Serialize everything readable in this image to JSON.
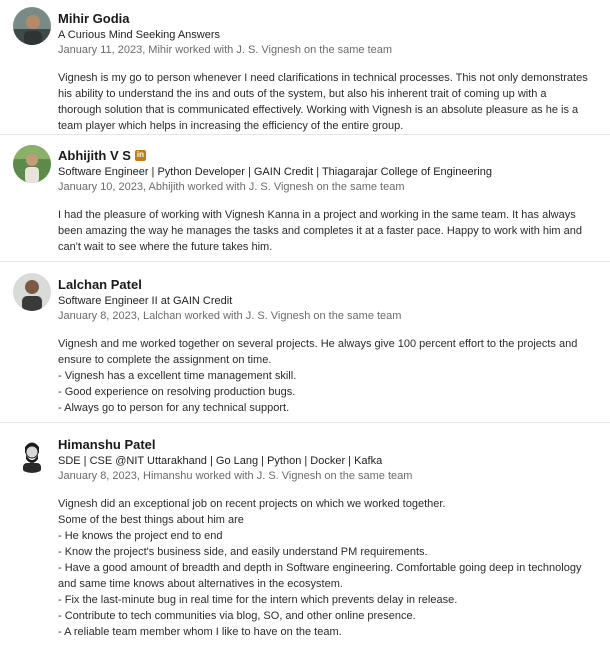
{
  "recommendations": [
    {
      "name": "Mihir Godia",
      "linkedin_badge": "",
      "headline": "A Curious Mind Seeking Answers",
      "meta": "January 11, 2023, Mihir worked with J. S. Vignesh on the same team",
      "body": [
        "Vignesh is my go to person whenever I need clarifications in technical processes. This not only demonstrates his ability to understand the ins and outs of the system, but also his inherent trait of coming up with a thorough solution that is communicated effectively. Working with Vignesh is an absolute pleasure as he is a team player which helps in increasing the efficiency of the entire group."
      ]
    },
    {
      "name": "Abhijith V S",
      "linkedin_badge": "in",
      "headline": "Software Engineer | Python Developer | GAIN Credit | Thiagarajar College of Engineering",
      "meta": "January 10, 2023, Abhijith worked with J. S. Vignesh on the same team",
      "body": [
        "I had the pleasure of working with Vignesh Kanna in a project and working in the same team. It has always been amazing the way he manages the tasks and completes it at a faster pace. Happy to work with him and can't wait to see where the future takes him."
      ]
    },
    {
      "name": "Lalchan Patel",
      "linkedin_badge": "",
      "headline": "Software Engineer II at GAIN Credit",
      "meta": "January 8, 2023, Lalchan worked with J. S. Vignesh on the same team",
      "body": [
        "Vignesh and me worked together on several projects. He always give 100 percent effort to the projects and ensure to complete the assignment on time.",
        "- Vignesh has a excellent time management skill.",
        "- Good experience on resolving production bugs.",
        "- Always go to person for any technical support."
      ]
    },
    {
      "name": "Himanshu Patel",
      "linkedin_badge": "",
      "headline": "SDE | CSE @NIT Uttarakhand | Go Lang | Python | Docker | Kafka",
      "meta": "January 8, 2023, Himanshu worked with J. S. Vignesh on the same team",
      "body": [
        "Vignesh did an exceptional job on recent projects on which we worked together.",
        "Some of the best things about him are",
        "- He knows the project end to end",
        "- Know the project's business side, and easily understand PM requirements.",
        "- Have a good amount of breadth and depth in Software engineering. Comfortable going deep in technology and same time knows about alternatives in the ecosystem.",
        "- Fix the last-minute bug in real time for the intern which prevents delay in release.",
        "- Contribute to tech communities via blog, SO, and other online presence.",
        "- A reliable team member whom I like to have on the team."
      ]
    }
  ]
}
